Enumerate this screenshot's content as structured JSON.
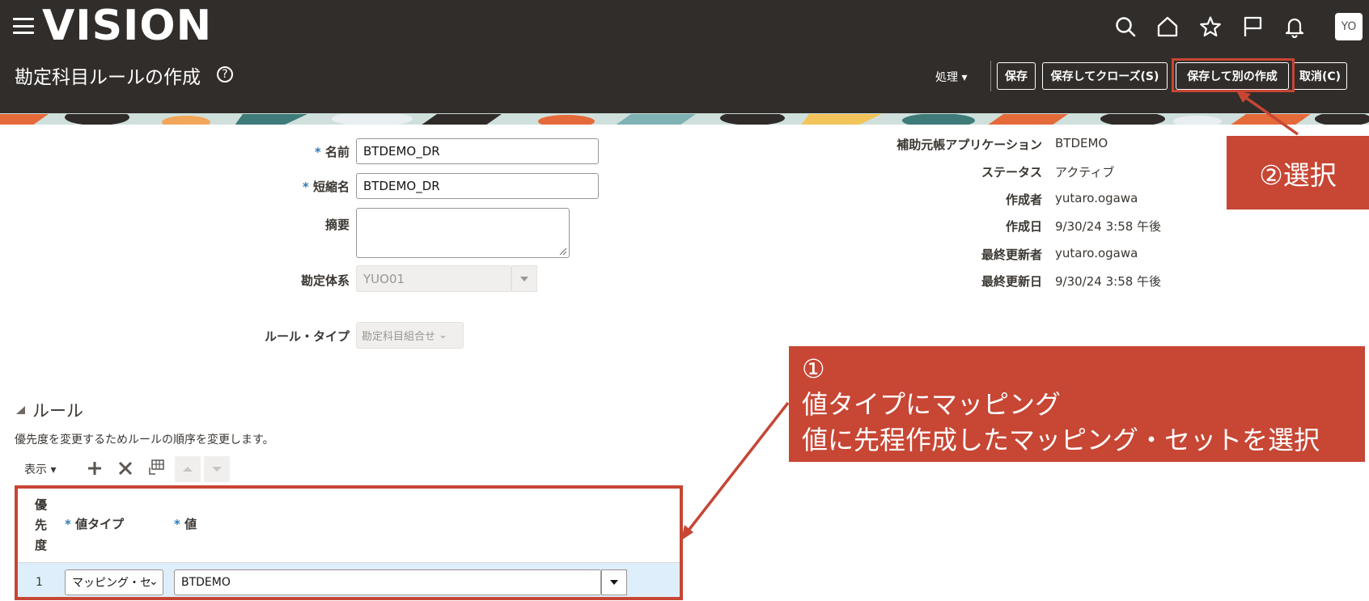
{
  "header": {
    "logo": "VISION",
    "title": "勘定科目ルールの作成",
    "avatar": "YO",
    "actions_label": "処理 ▾",
    "buttons": {
      "save": "保存",
      "save_close": "保存してクローズ(S)",
      "save_create_another": "保存して別の作成",
      "cancel": "取消(C)"
    }
  },
  "form": {
    "name_label": "名前",
    "name_value": "BTDEMO_DR",
    "short_name_label": "短縮名",
    "short_name_value": "BTDEMO_DR",
    "description_label": "摘要",
    "description_value": "",
    "chart_of_accounts_label": "勘定体系",
    "chart_of_accounts_value": "YUO01",
    "rule_type_label": "ルール・タイプ",
    "rule_type_value": "勘定科目組合せ"
  },
  "info": {
    "subledger_app_label": "補助元帳アプリケーション",
    "subledger_app_value": "BTDEMO",
    "status_label": "ステータス",
    "status_value": "アクティブ",
    "created_by_label": "作成者",
    "created_by_value": "yutaro.ogawa",
    "creation_date_label": "作成日",
    "creation_date_value": "9/30/24 3:58 午後",
    "last_updated_by_label": "最終更新者",
    "last_updated_by_value": "yutaro.ogawa",
    "last_update_date_label": "最終更新日",
    "last_update_date_value": "9/30/24 3:58 午後"
  },
  "rules": {
    "section_title": "ルール",
    "instruction": "優先度を変更するためルールの順序を変更します。",
    "view_label": "表示 ▾",
    "columns": {
      "priority": "優\n先\n度",
      "value_type": "値タイプ",
      "value": "値"
    },
    "rows": [
      {
        "priority": "1",
        "value_type": "マッピング・セ",
        "value": "BTDEMO"
      }
    ]
  },
  "annotations": {
    "callout1_num": "①",
    "callout1_line1": "値タイプにマッピング",
    "callout1_line2": "値に先程作成したマッピング・セットを選択",
    "callout2": "②選択"
  },
  "colors": {
    "header_bg": "#312d2a",
    "callout_red": "#c74634",
    "required_star": "#2f7bb5",
    "selected_row": "#deeefa"
  }
}
